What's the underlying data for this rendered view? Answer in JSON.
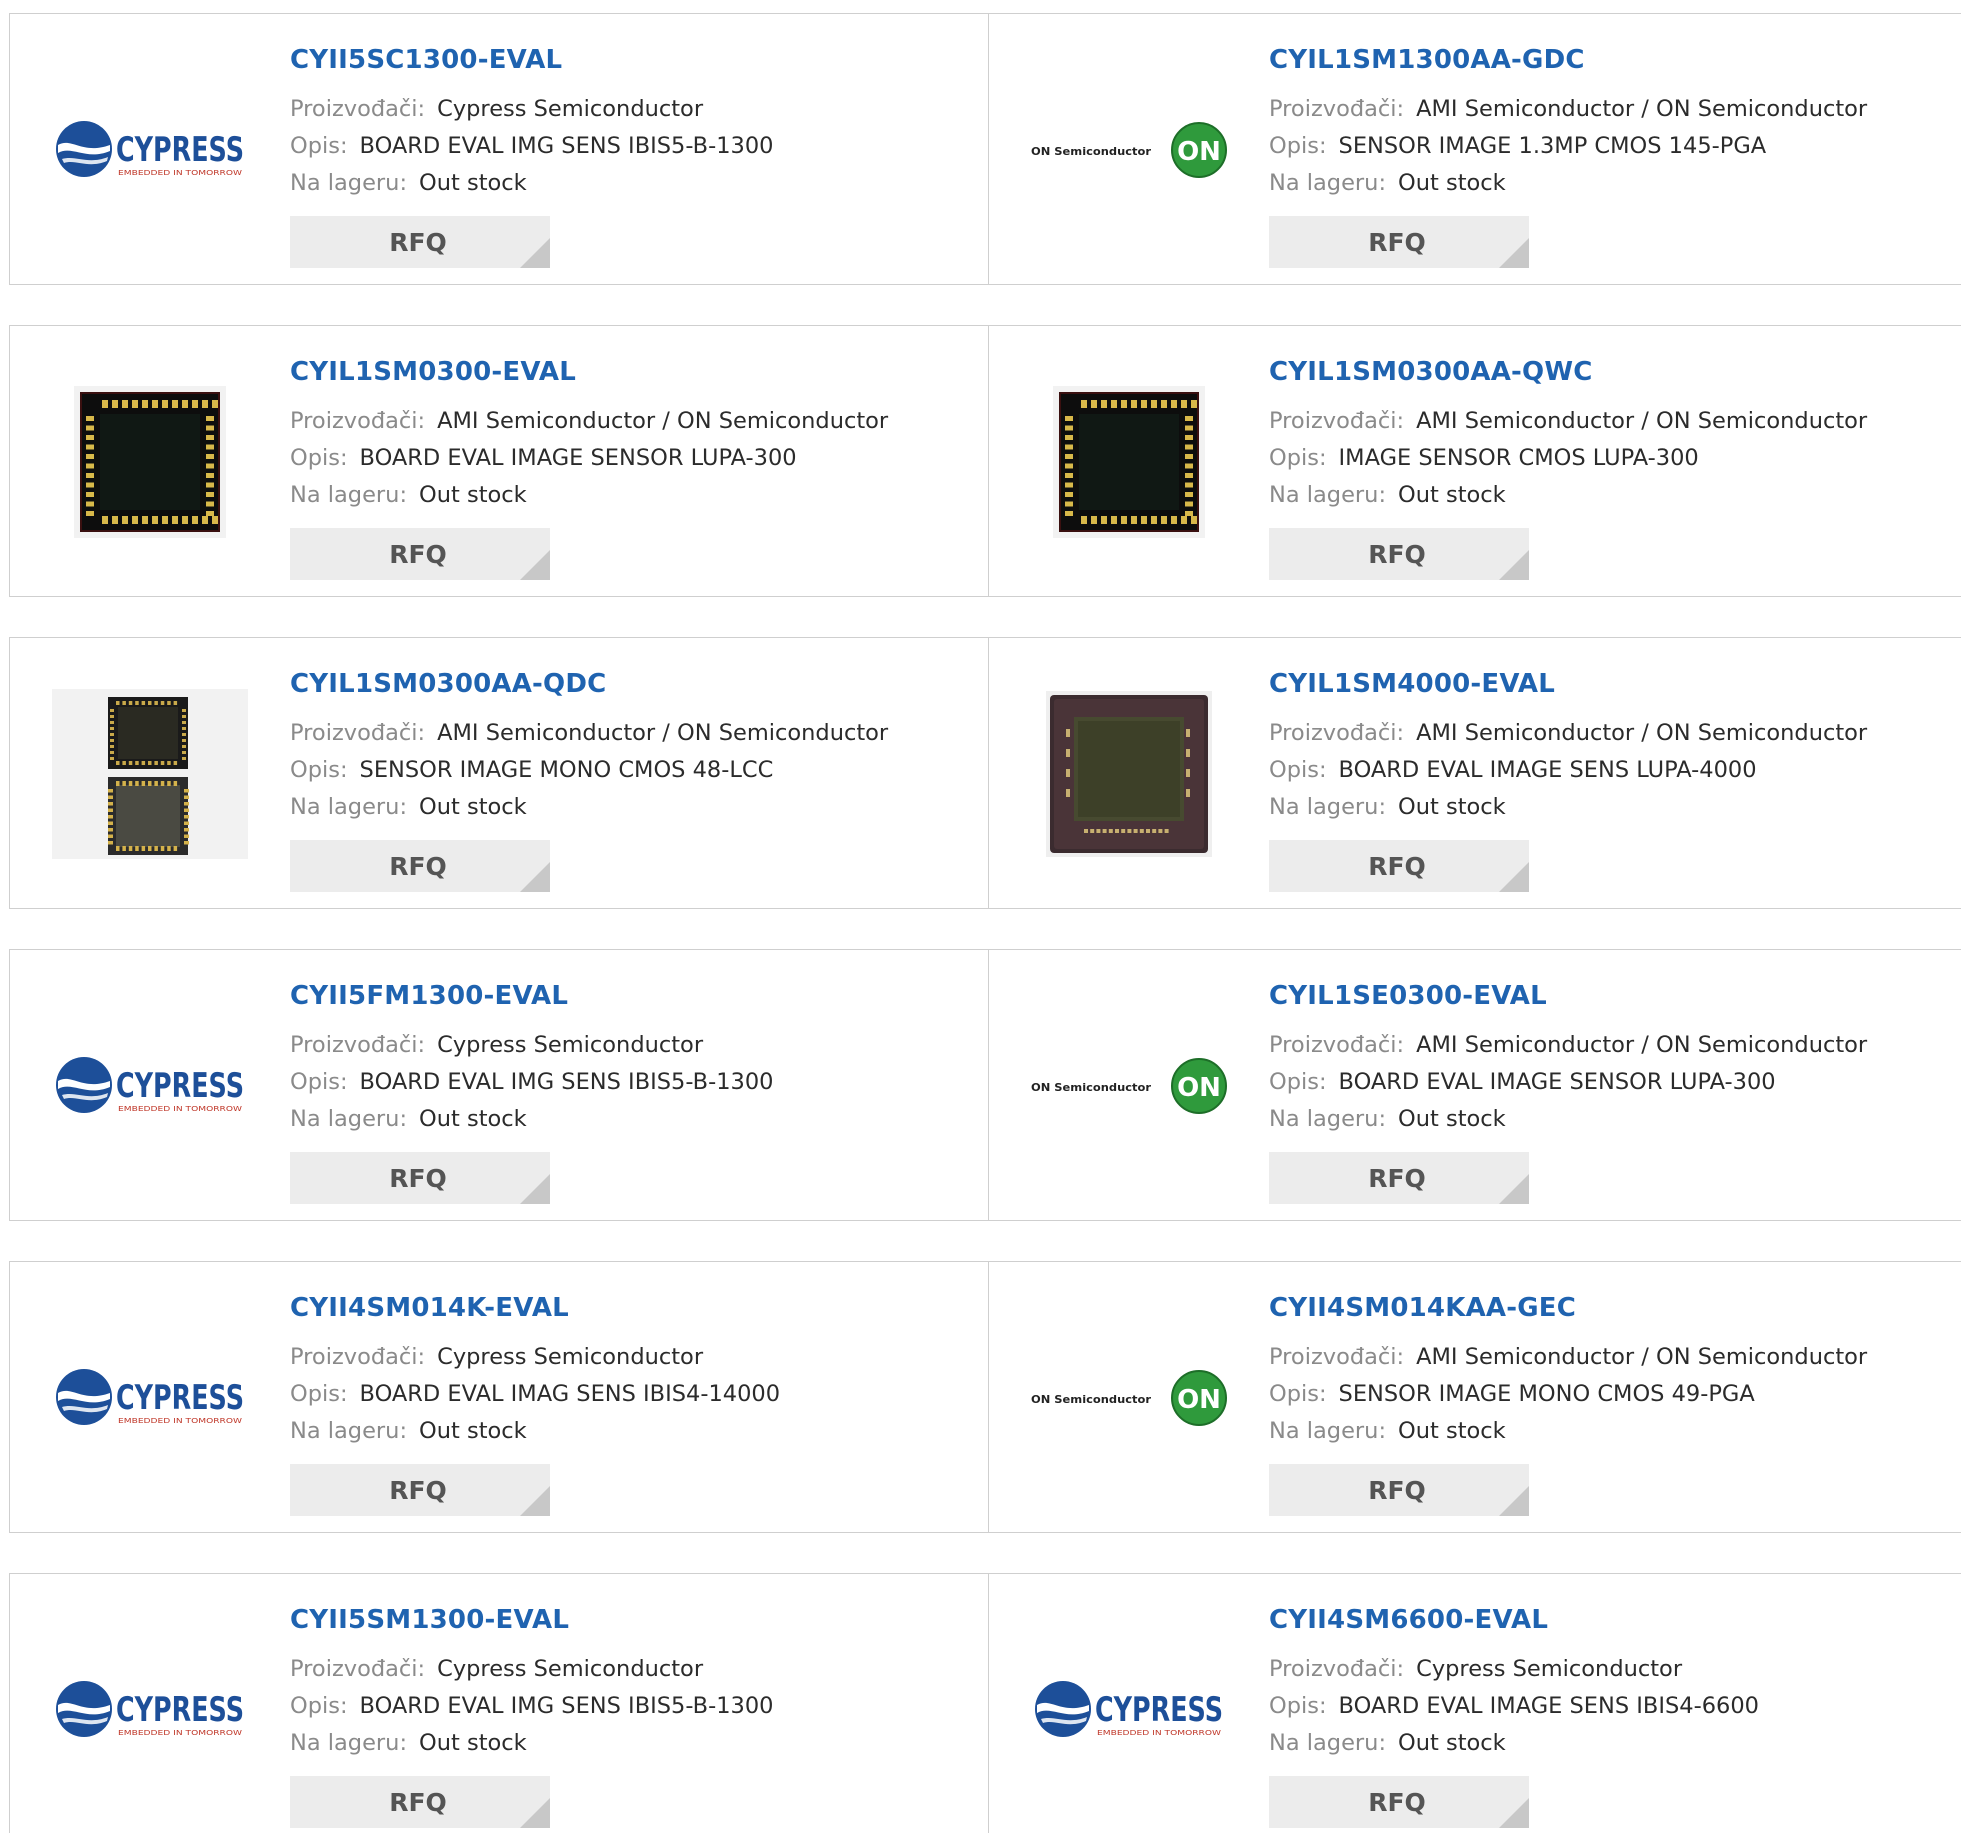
{
  "labels": {
    "manufacturer": "Proizvođači:",
    "description": "Opis:",
    "stock": "Na lageru:",
    "rfq": "RFQ"
  },
  "logos": {
    "cypress_text": "CYPRESS",
    "cypress_tagline": "EMBEDDED IN TOMORROW",
    "on_text": "ON Semiconductor",
    "on_badge": "ON"
  },
  "colors": {
    "title": "#1f63b0",
    "label": "#8a8a8a",
    "value": "#2b2b2b",
    "button_bg": "#ececec",
    "button_text": "#555555",
    "border": "#cfcfcf",
    "cypress_blue": "#1d4f99",
    "on_green": "#2f9a3c"
  },
  "rows": [
    [
      {
        "title": "CYII5SC1300-EVAL",
        "manufacturer": "Cypress Semiconductor",
        "description": "BOARD EVAL IMG SENS IBIS5-B-1300",
        "stock": "Out stock",
        "image": "cypress-logo"
      },
      {
        "title": "CYIL1SM1300AA-GDC",
        "manufacturer": "AMI Semiconductor / ON Semiconductor",
        "description": "SENSOR IMAGE 1.3MP CMOS 145-PGA",
        "stock": "Out stock",
        "image": "on-semi-logo"
      }
    ],
    [
      {
        "title": "CYIL1SM0300-EVAL",
        "manufacturer": "AMI Semiconductor / ON Semiconductor",
        "description": "BOARD EVAL IMAGE SENSOR LUPA-300",
        "stock": "Out stock",
        "image": "lcc-chip"
      },
      {
        "title": "CYIL1SM0300AA-QWC",
        "manufacturer": "AMI Semiconductor / ON Semiconductor",
        "description": "IMAGE SENSOR CMOS LUPA-300",
        "stock": "Out stock",
        "image": "lcc-chip"
      }
    ],
    [
      {
        "title": "CYIL1SM0300AA-QDC",
        "manufacturer": "AMI Semiconductor / ON Semiconductor",
        "description": "SENSOR IMAGE MONO CMOS 48-LCC",
        "stock": "Out stock",
        "image": "two-chips"
      },
      {
        "title": "CYIL1SM4000-EVAL",
        "manufacturer": "AMI Semiconductor / ON Semiconductor",
        "description": "BOARD EVAL IMAGE SENS LUPA-4000",
        "stock": "Out stock",
        "image": "large-sensor"
      }
    ],
    [
      {
        "title": "CYII5FM1300-EVAL",
        "manufacturer": "Cypress Semiconductor",
        "description": "BOARD EVAL IMG SENS IBIS5-B-1300",
        "stock": "Out stock",
        "image": "cypress-logo"
      },
      {
        "title": "CYIL1SE0300-EVAL",
        "manufacturer": "AMI Semiconductor / ON Semiconductor",
        "description": "BOARD EVAL IMAGE SENSOR LUPA-300",
        "stock": "Out stock",
        "image": "on-semi-logo"
      }
    ],
    [
      {
        "title": "CYII4SM014K-EVAL",
        "manufacturer": "Cypress Semiconductor",
        "description": "BOARD EVAL IMAG SENS IBIS4-14000",
        "stock": "Out stock",
        "image": "cypress-logo"
      },
      {
        "title": "CYII4SM014KAA-GEC",
        "manufacturer": "AMI Semiconductor / ON Semiconductor",
        "description": "SENSOR IMAGE MONO CMOS 49-PGA",
        "stock": "Out stock",
        "image": "on-semi-logo"
      }
    ],
    [
      {
        "title": "CYII5SM1300-EVAL",
        "manufacturer": "Cypress Semiconductor",
        "description": "BOARD EVAL IMG SENS IBIS5-B-1300",
        "stock": "Out stock",
        "image": "cypress-logo"
      },
      {
        "title": "CYII4SM6600-EVAL",
        "manufacturer": "Cypress Semiconductor",
        "description": "BOARD EVAL IMAGE SENS IBIS4-6600",
        "stock": "Out stock",
        "image": "cypress-logo"
      }
    ]
  ]
}
